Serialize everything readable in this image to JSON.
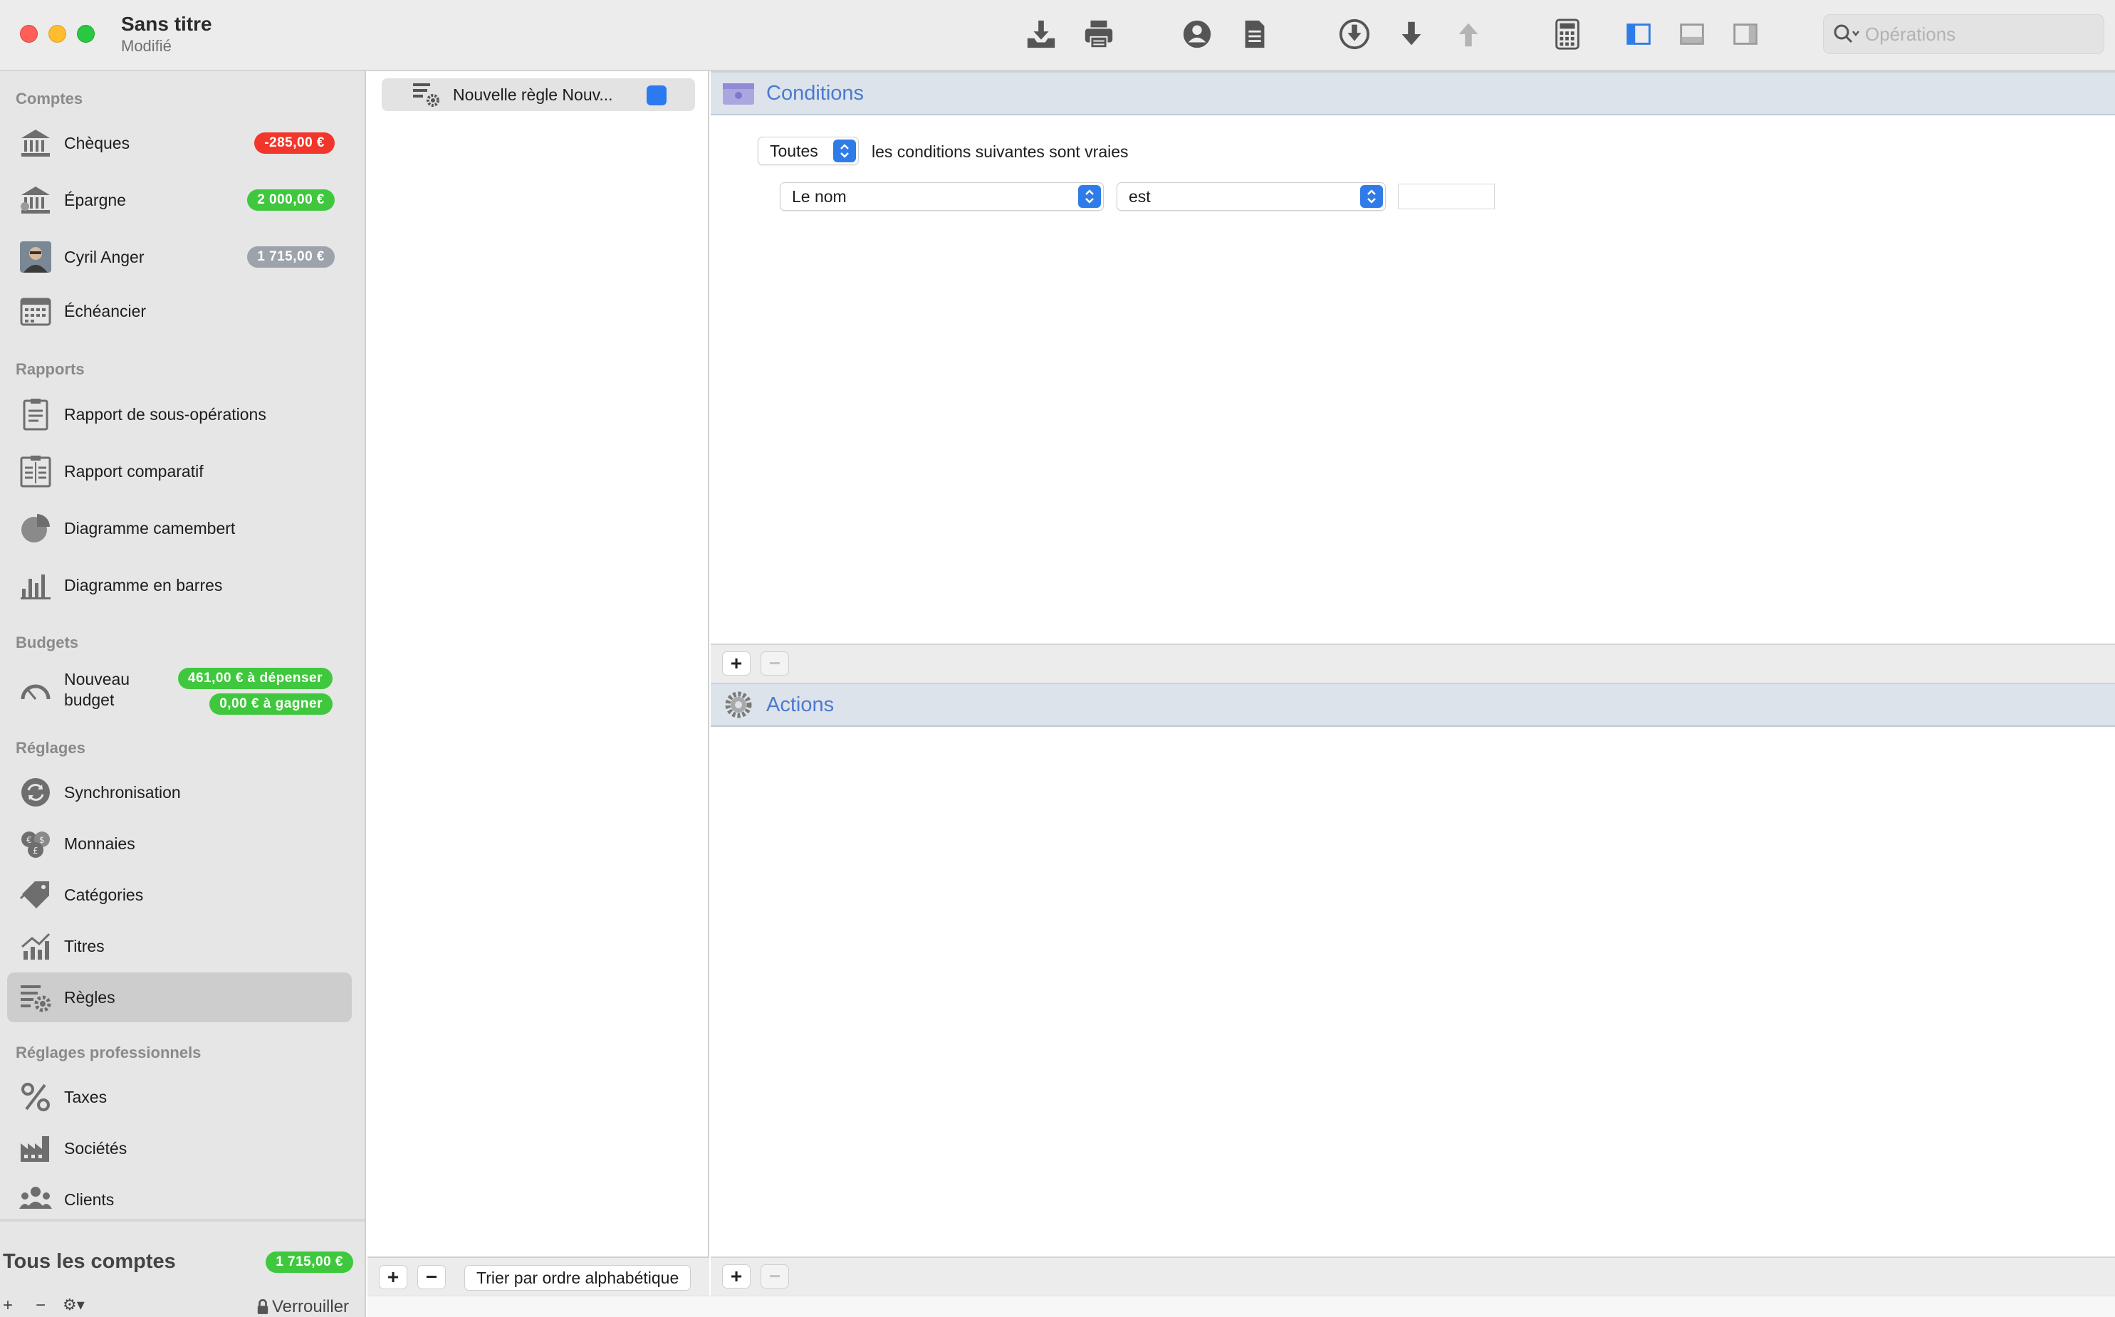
{
  "window": {
    "title": "Sans titre",
    "subtitle": "Modifié"
  },
  "toolbar": {
    "icons": [
      "import-icon",
      "print-icon",
      "account-icon",
      "report-icon",
      "download-circle-icon",
      "arrow-down-icon",
      "arrow-up-icon",
      "calculator-icon",
      "sidebar-left-icon",
      "panel-bottom-icon",
      "sidebar-right-icon"
    ],
    "search_placeholder": "Opérations"
  },
  "sidebar": {
    "sections": {
      "accounts": "Comptes",
      "reports": "Rapports",
      "budgets": "Budgets",
      "settings": "Réglages",
      "pro_settings": "Réglages professionnels"
    },
    "accounts": [
      {
        "label": "Chèques",
        "badge": "-285,00 €",
        "badge_color": "#f2362b"
      },
      {
        "label": "Épargne",
        "badge": "2 000,00 €",
        "badge_color": "#3fc83d"
      },
      {
        "label": "Cyril Anger",
        "badge": "1 715,00 €",
        "badge_color": "#9da2ab"
      },
      {
        "label": "Échéancier"
      }
    ],
    "reports": [
      {
        "label": "Rapport de sous-opérations"
      },
      {
        "label": "Rapport comparatif"
      },
      {
        "label": "Diagramme camembert"
      },
      {
        "label": "Diagramme en barres"
      }
    ],
    "budget": {
      "label": "Nouveau budget",
      "spend_badge": "461,00 € à dépenser",
      "earn_badge": "0,00 € à gagner"
    },
    "settings": [
      {
        "label": "Synchronisation"
      },
      {
        "label": "Monnaies"
      },
      {
        "label": "Catégories"
      },
      {
        "label": "Titres"
      },
      {
        "label": "Règles",
        "selected": true
      }
    ],
    "pro_settings": [
      {
        "label": "Taxes"
      },
      {
        "label": "Sociétés"
      },
      {
        "label": "Clients"
      }
    ],
    "footer": {
      "all_accounts_label": "Tous les comptes",
      "all_accounts_badge": "1 715,00 €",
      "add": "+",
      "remove": "−",
      "gear": "⚙▾",
      "lock_label": "Verrouiller"
    }
  },
  "rules": {
    "items": [
      {
        "label": "Nouvelle règle Nouv...",
        "enabled": true
      }
    ],
    "bottom": {
      "add": "+",
      "remove": "−",
      "sort_label": "Trier par ordre alphabétique"
    }
  },
  "editor": {
    "conditions": {
      "title": "Conditions",
      "match_mode": "Toutes",
      "match_text": "les conditions suivantes sont vraies",
      "rows": [
        {
          "field": "Le nom",
          "operator": "est",
          "value": ""
        }
      ],
      "add": "+",
      "remove": "−"
    },
    "actions": {
      "title": "Actions",
      "add": "+",
      "remove": "−"
    }
  },
  "colors": {
    "accent_blue": "#2f7ce8",
    "section_title_blue": "#4b7ad0",
    "badge_red": "#f2362b",
    "badge_green": "#3fc83d",
    "badge_gray": "#9da2ab"
  }
}
